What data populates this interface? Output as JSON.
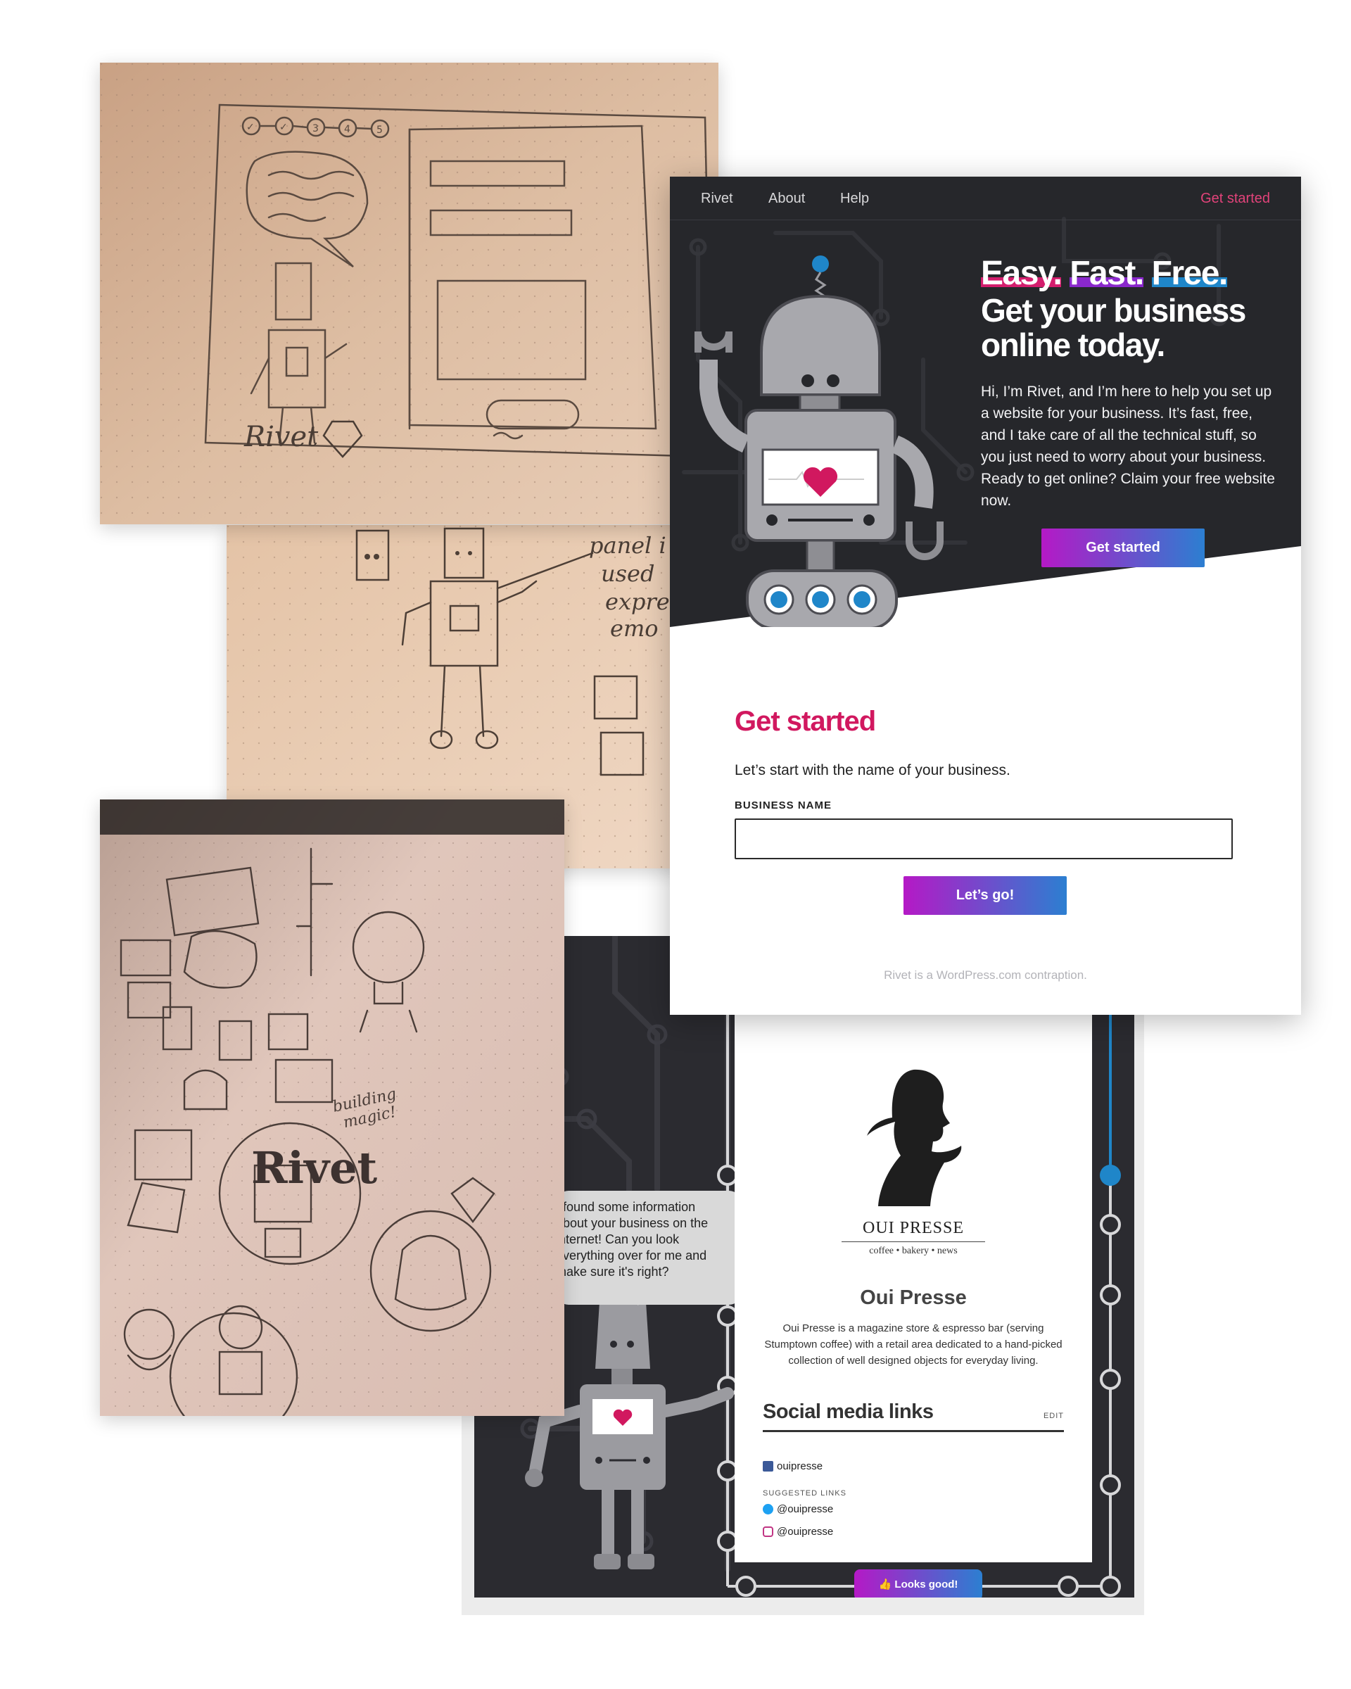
{
  "sketch_top": {
    "steps": [
      "✓",
      "✓",
      "3",
      "4",
      "5"
    ],
    "signature": "Rivet"
  },
  "sketch_mid": {
    "note_lines": [
      "panel i",
      "used",
      "expre",
      "emo"
    ]
  },
  "sketch_bottom": {
    "note": [
      "building",
      "magic!"
    ],
    "wordmark": "Rivet"
  },
  "rivet_app": {
    "nav": {
      "brand": "Rivet",
      "about": "About",
      "help": "Help",
      "cta": "Get started"
    },
    "hero": {
      "tagline_words": [
        "Easy.",
        "Fast.",
        "Free."
      ],
      "headline": "Get your business online today.",
      "intro": "Hi, I’m Rivet, and I’m here to help you set up a website for your business. It’s fast, free, and I take care of all the technical stuff, so you just need to worry about your business. Ready to get online? Claim your free website now.",
      "button": "Get started"
    },
    "form": {
      "title": "Get started",
      "lead": "Let’s start with the name of your business.",
      "field_label": "BUSINESS NAME",
      "field_value": "",
      "submit": "Let’s go!"
    },
    "footer": "Rivet is a WordPress.com contraption.",
    "colors": {
      "dark": "#26272b",
      "accent_pink": "#d1185f",
      "accent_purple": "#8a28cc",
      "accent_blue": "#1f86c9"
    }
  },
  "oui_presse": {
    "bubble_lines": [
      "I found some information",
      "about your business on the",
      "internet! Can you look",
      "everything over for me and",
      "make sure it's right?"
    ],
    "logo_wordmark": "OUI PRESSE",
    "logo_tagline": "coffee • bakery • news",
    "business_name": "Oui Presse",
    "description": "Oui Presse is a magazine store & espresso bar (serving Stumptown coffee) with a retail area dedicated to a hand-picked collection of well designed objects for everyday living.",
    "social_title": "Social media links",
    "edit_label": "EDIT",
    "facebook": "ouipresse",
    "suggested_label": "SUGGESTED LINKS",
    "twitter": "@ouipresse",
    "instagram": "@ouipresse",
    "confirm_button": "👍 Looks good!"
  }
}
